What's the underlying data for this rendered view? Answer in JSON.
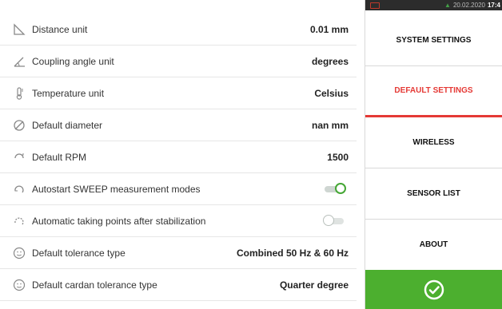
{
  "settings": [
    {
      "label": "Distance unit",
      "value": "0.01 mm",
      "icon": "ruler-angle-icon"
    },
    {
      "label": "Coupling angle unit",
      "value": "degrees",
      "icon": "angle-icon"
    },
    {
      "label": "Temperature unit",
      "value": "Celsius",
      "icon": "thermometer-icon"
    },
    {
      "label": "Default diameter",
      "value": "nan mm",
      "icon": "diameter-icon"
    },
    {
      "label": "Default RPM",
      "value": "1500",
      "icon": "rpm-icon"
    },
    {
      "label": "Autostart SWEEP measurement modes",
      "toggle": true,
      "icon": "auto-rotate-icon"
    },
    {
      "label": "Automatic taking points after stabilization",
      "toggle": false,
      "icon": "auto-points-icon"
    },
    {
      "label": "Default tolerance type",
      "value": "Combined 50 Hz & 60 Hz",
      "icon": "smiley-icon"
    },
    {
      "label": "Default cardan tolerance type",
      "value": "Quarter degree",
      "icon": "smiley-icon"
    }
  ],
  "status_bar": {
    "date": "20.02.2020",
    "time": "17:4"
  },
  "menu": {
    "system": "SYSTEM SETTINGS",
    "default": "DEFAULT SETTINGS",
    "wireless": "WIRELESS",
    "sensor": "SENSOR LIST",
    "about": "ABOUT"
  },
  "colors": {
    "accent_red": "#e53935",
    "confirm_green": "#4caf2f",
    "toggle_green": "#45a735"
  }
}
